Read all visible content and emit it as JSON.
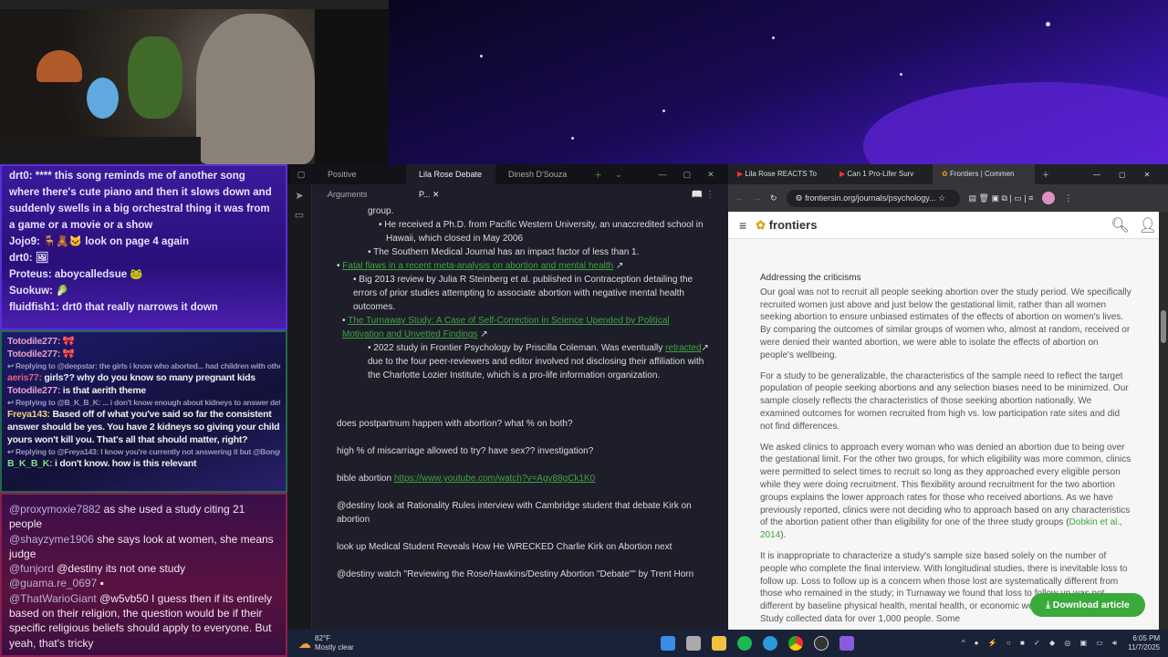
{
  "chat": {
    "section1": [
      {
        "user": "drt0:",
        "text": "**** this song reminds me of another song where there's cute piano and then it slows down and suddenly swells in a big orchestral thing it was from a game or a movie or a show"
      },
      {
        "user": "Jojo9:",
        "text": "look on page 4 again"
      },
      {
        "user": "drt0:",
        "text": ""
      },
      {
        "user": "Proteus:",
        "text": "aboycalledsue"
      },
      {
        "user": "Suokuw:",
        "text": ""
      },
      {
        "user": "fluidfish1:",
        "text": "drt0 that really narrows it down"
      }
    ],
    "section2": [
      {
        "user": "Totodile277:",
        "text": ""
      },
      {
        "user": "Totodile277:",
        "text": ""
      },
      {
        "reply": "Replying to @deepstar: the girls i know who aborted... had children with othe..."
      },
      {
        "user": "aeris77:",
        "text": "girls?? why do you know so many pregnant kids"
      },
      {
        "user": "Totodile277:",
        "text": "is that aerith theme"
      },
      {
        "reply": "Replying to @B_K_B_K: ... i don't know enough about kidneys to answer def..."
      },
      {
        "user": "Freya143:",
        "text": "Based off of what you've said so far the consistent answer should be yes. You have 2 kidneys so giving your child yours won't kill you. That's all that should matter, right?"
      },
      {
        "reply": "Replying to @Freya143: I know you're currently not answering it but @BongC..."
      },
      {
        "user": "B_K_B_K:",
        "text": "i don't know. how is this relevant"
      }
    ],
    "section3": [
      {
        "user": "@proxymoxie7882",
        "text": "as she used a study citing 21 people"
      },
      {
        "user": "@shayzyme1906",
        "text": "she says look at women, she means judge"
      },
      {
        "user": "@funjord",
        "text": "@destiny its not one study"
      },
      {
        "user": "@guama.re_0697",
        "text": ""
      },
      {
        "user": "@ThatWarioGiant",
        "text": "@w5vb50 I guess then if its entirely based on their religion, the question would be if their specific religious beliefs should apply to everyone. But yeah, that's tricky"
      }
    ]
  },
  "obsidian": {
    "tabs": [
      "Positive Arguments",
      "Lila Rose Debate P...",
      "Dinesh D'Souza"
    ],
    "lines": {
      "l0": "group.",
      "l1": "He received a Ph.D. from Pacific Western University, an unaccredited school in Hawaii, which closed in May 2006",
      "l2": "The Southern Medical Journal has an impact factor of less than 1.",
      "link1": "Fatal flaws in a recent meta-analysis on abortion and mental health",
      "l3": "Big 2013 review by Julia R Steinberg et al. published in Contraception detailing the errors of prior studies attempting to associate abortion with negative mental health outcomes.",
      "link2": "The Turnaway Study: A Case of Self-Correction in Science Upended by Political Motivation and Unvetted Findings",
      "l4a": "2022 study in Frontier Psychology by Priscilla Coleman. Was eventually",
      "l4link": "retracted",
      "l4b": "due to the four peer-reviewers and editor involved not disclosing their affiliation with the Charlotte Lozier Institute, which is a pro-life information organization."
    },
    "notes": [
      "does postpartnum happen with abortion? what % on both?",
      "high % of miscarriage allowed to try? have sex?? investigation?",
      "@destiny look at Rationality Rules interview with Cambridge student that debate Kirk on abortion",
      "look up Medical Student Reveals How He WRECKED Charlie Kirk on Abortion next",
      "@destiny watch \"Reviewing the Rose/Hawkins/Destiny Abortion \"Debate\"\" by Trent Horn"
    ],
    "bible_label": "bible abortion",
    "bible_url": "https://www.youtube.com/watch?v=Agy88gCk1K0"
  },
  "chrome": {
    "tabs": [
      "Lila Rose REACTS To",
      "Can 1 Pro-Lifer Surv",
      "Frontiers | Commen"
    ],
    "url": "frontiersin.org/journals/psychology...",
    "brand": "frontiers",
    "heading": "Addressing the criticisms",
    "p1": "Our goal was not to recruit all people seeking abortion over the study period. We specifically recruited women just above and just below the gestational limit, rather than all women seeking abortion to ensure unbiased estimates of the effects of abortion on women's lives. By comparing the outcomes of similar groups of women who, almost at random, received or were denied their wanted abortion, we were able to isolate the effects of abortion on people's wellbeing.",
    "p2": "For a study to be generalizable, the characteristics of the sample need to reflect the target population of people seeking abortions and any selection biases need to be minimized. Our sample closely reflects the characteristics of those seeking abortion nationally. We examined outcomes for women recruited from high vs. low participation rate sites and did not find differences.",
    "p3": "We asked clinics to approach every woman who was denied an abortion due to being over the gestational limit. For the other two groups, for which eligibility was more common, clinics were permitted to select times to recruit so long as they approached every eligible person while they were doing recruitment. This flexibility around recruitment for the two abortion groups explains the lower approach rates for those who received abortions. As we have previously reported, clinics were not deciding who to approach based on any characteristics of the abortion patient other than eligibility for one of the three study groups (",
    "p3cite": "Dobkin et al., 2014",
    "p3end": ").",
    "p4": "It is inappropriate to characterize a study's sample size based solely on the number of people who complete the final interview. With longitudinal studies, there is inevitable loss to follow up. Loss to follow up is a concern when those lost are systematically different from those who remained in the study; in Turnaway we found that loss to follow up was not different by baseline physical health, mental health, or economic wellbeing. The Turnaway Study collected data for over 1,000 people. Some",
    "download": "Download article"
  },
  "taskbar": {
    "temp": "82°F",
    "weather": "Mostly clear",
    "time": "6:05 PM",
    "date": "11/7/2025"
  }
}
